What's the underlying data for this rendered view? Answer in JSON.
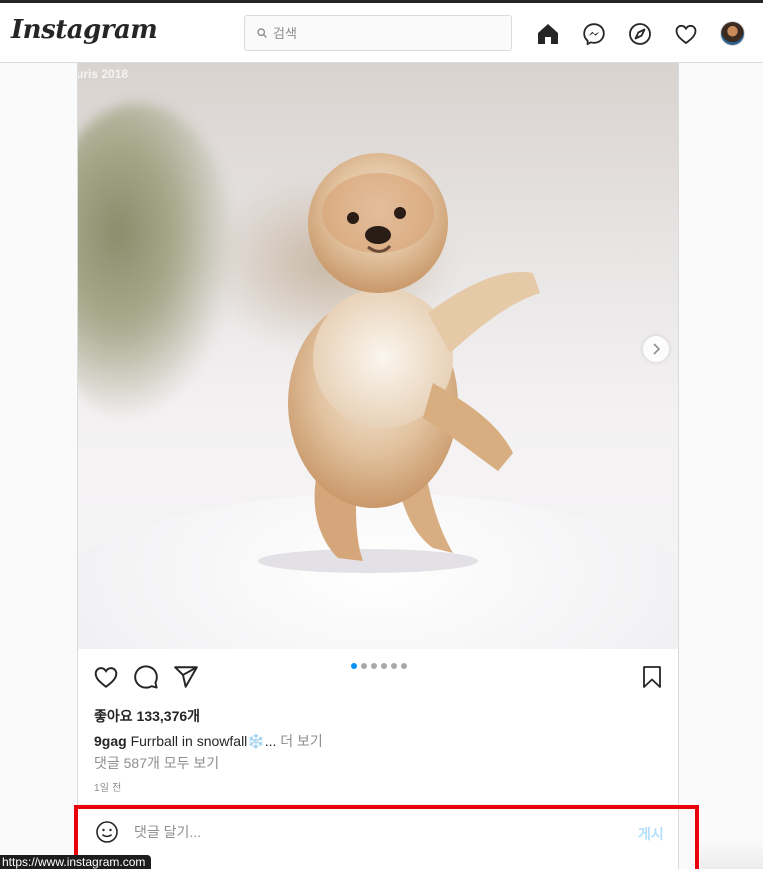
{
  "nav": {
    "logo": "Instagram",
    "search_placeholder": "검색",
    "icons": [
      "home-icon",
      "messenger-icon",
      "explore-icon",
      "activity-heart-icon",
      "profile-avatar"
    ]
  },
  "post": {
    "photo_watermark": "uris 2018",
    "carousel": {
      "count": 6,
      "active_index": 0
    },
    "likes": "좋아요 133,376개",
    "caption": {
      "username": "9gag",
      "text": "Furrball in snowfall❄️...",
      "more": "더 보기"
    },
    "view_comments": "댓글 587개 모두 보기",
    "time": "1일 전",
    "comment_placeholder": "댓글 달기...",
    "post_button": "게시"
  },
  "status": {
    "url_tooltip": "https://www.instagram.com"
  },
  "colors": {
    "accent": "#0095f6",
    "post_button_disabled": "#b2dffc",
    "highlight": "#e8000b"
  }
}
